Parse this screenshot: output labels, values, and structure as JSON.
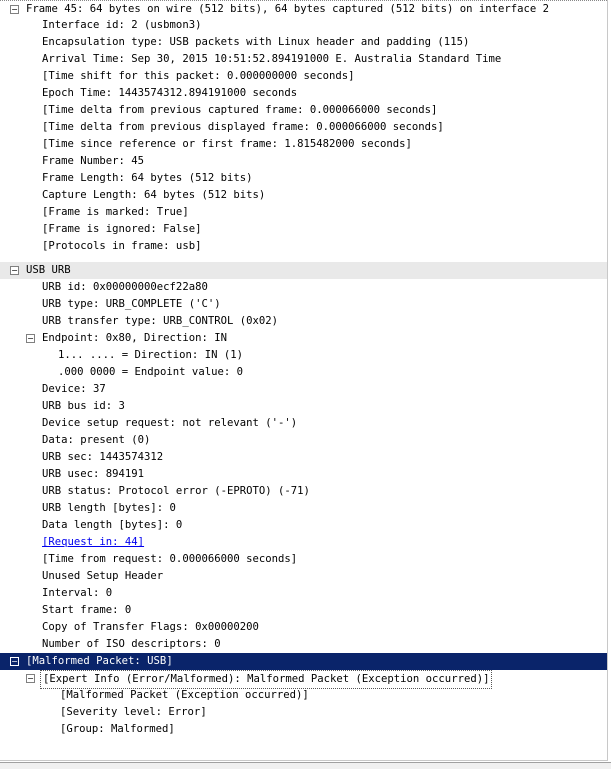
{
  "tree": {
    "frame": {
      "header": "Frame 45: 64 bytes on wire (512 bits), 64 bytes captured (512 bits) on interface 2",
      "fields": [
        "Interface id: 2 (usbmon3)",
        "Encapsulation type: USB packets with Linux header and padding (115)",
        "Arrival Time: Sep 30, 2015 10:51:52.894191000 E. Australia Standard Time",
        "[Time shift for this packet: 0.000000000 seconds]",
        "Epoch Time: 1443574312.894191000 seconds",
        "[Time delta from previous captured frame: 0.000066000 seconds]",
        "[Time delta from previous displayed frame: 0.000066000 seconds]",
        "[Time since reference or first frame: 1.815482000 seconds]",
        "Frame Number: 45",
        "Frame Length: 64 bytes (512 bits)",
        "Capture Length: 64 bytes (512 bits)",
        "[Frame is marked: True]",
        "[Frame is ignored: False]",
        "[Protocols in frame: usb]"
      ]
    },
    "usb": {
      "header": "USB URB",
      "fields_top": [
        "URB id: 0x00000000ecf22a80",
        "URB type: URB_COMPLETE ('C')",
        "URB transfer type: URB_CONTROL (0x02)"
      ],
      "endpoint": {
        "header": "Endpoint: 0x80, Direction: IN",
        "fields": [
          "1... .... = Direction: IN (1)",
          ".000 0000 = Endpoint value: 0"
        ]
      },
      "fields_mid": [
        "Device: 37",
        "URB bus id: 3",
        "Device setup request: not relevant ('-')",
        "Data: present (0)",
        "URB sec: 1443574312",
        "URB usec: 894191",
        "URB status: Protocol error (-EPROTO) (-71)",
        "URB length [bytes]: 0",
        "Data length [bytes]: 0"
      ],
      "request_link": "[Request in: 44]",
      "fields_bottom": [
        "[Time from request: 0.000066000 seconds]",
        "Unused Setup Header",
        "Interval: 0",
        "Start frame: 0",
        "Copy of Transfer Flags: 0x00000200",
        "Number of ISO descriptors: 0"
      ]
    },
    "malformed": {
      "header": "[Malformed Packet: USB]",
      "expert": {
        "header": "[Expert Info (Error/Malformed): Malformed Packet (Exception occurred)]",
        "fields": [
          "[Malformed Packet (Exception occurred)]",
          "[Severity level: Error]",
          "[Group: Malformed]"
        ]
      }
    },
    "toggle_glyph": "−"
  },
  "colors": {
    "selected_bg": "#0a246a",
    "section_bg": "#e9e9e9",
    "link": "#0000ee"
  }
}
